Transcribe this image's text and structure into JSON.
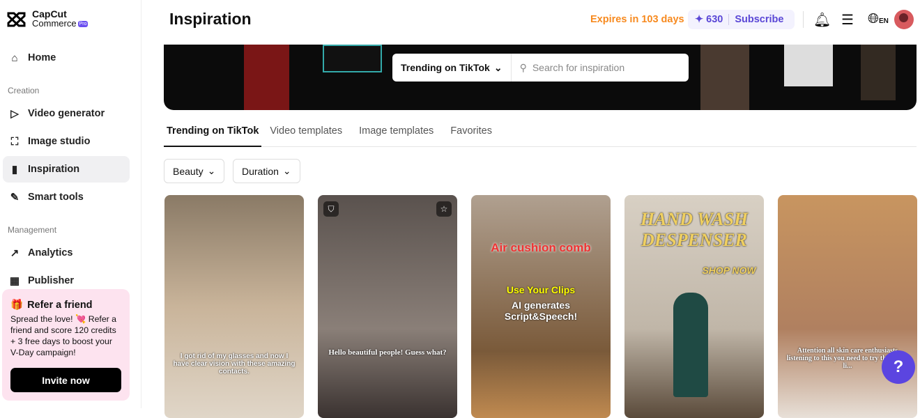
{
  "logo": {
    "line1": "CapCut",
    "line2": "Commerce",
    "badge": "Pro"
  },
  "sidebar": {
    "items": [
      {
        "label": "Home",
        "icon": "home-icon"
      },
      {
        "label": "Video generator",
        "icon": "video-generator-icon"
      },
      {
        "label": "Image studio",
        "icon": "image-icon"
      },
      {
        "label": "Inspiration",
        "icon": "inspiration-icon"
      },
      {
        "label": "Smart tools",
        "icon": "magic-wand-icon"
      },
      {
        "label": "Analytics",
        "icon": "analytics-icon"
      },
      {
        "label": "Publisher",
        "icon": "calendar-icon"
      }
    ],
    "section_creation": "Creation",
    "section_management": "Management"
  },
  "refer": {
    "title": "Refer a friend",
    "text": "Spread the love! 💘 Refer a friend and score 120 credits + 3 free days to boost your V-Day campaign!",
    "button": "Invite now"
  },
  "header": {
    "title": "Inspiration",
    "expires": "Expires in 103 days",
    "credits": "630",
    "subscribe": "Subscribe",
    "lang": "EN"
  },
  "search": {
    "source": "Trending on TikTok",
    "placeholder": "Search for inspiration"
  },
  "tabs": [
    "Trending on TikTok",
    "Video templates",
    "Image templates",
    "Favorites"
  ],
  "filters": [
    "Beauty",
    "Duration"
  ],
  "cards": [
    {
      "caption": "I got rid of my glasses and now I have clear vision with these amazing contacts.",
      "bg": "#b8a58c"
    },
    {
      "caption": "Hello beautiful people! Guess what?",
      "bg": "#6e6460"
    },
    {
      "title": "Air cushion comb",
      "line1": "Use Your Clips",
      "line2": "AI generates Script&Speech!",
      "bg": "#9c8a78"
    },
    {
      "title": "HAND WASH DESPENSER",
      "sub": "SHOP NOW",
      "bg": "#c9c0b2"
    },
    {
      "caption": "Attention all skin care enthusiasts listening to this you need to try this Baby li...",
      "bg": "#b98a5e"
    }
  ],
  "colors": {
    "accent": "#5b45e0",
    "expires": "#f78a1f",
    "refer_bg": "#fde3ef"
  }
}
